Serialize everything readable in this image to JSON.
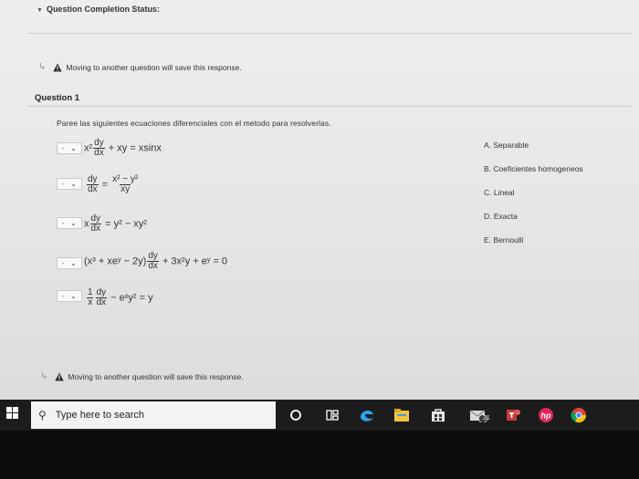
{
  "status": {
    "title": "Question Completion Status:"
  },
  "notice_top": "Moving to another question will save this response.",
  "question": {
    "title": "Question 1",
    "instructions": "Paree las siguientes ecuaciones  diferenciales con el metodo para resolverlas."
  },
  "selects": [
    {
      "value": "-",
      "caret": "⌄"
    },
    {
      "value": "-",
      "caret": "⌄"
    },
    {
      "value": "-",
      "caret": "⌄"
    },
    {
      "value": "-",
      "caret": "⌄"
    },
    {
      "value": "-",
      "caret": "⌄"
    }
  ],
  "equations": {
    "eq1": {
      "coef": "x²",
      "num": "dy",
      "den": "dx",
      "rest": "+ xy = xsinx"
    },
    "eq2": {
      "num": "dy",
      "den": "dx",
      "eq": "=",
      "rnum": "x² − y²",
      "rden": "xy"
    },
    "eq3": {
      "coef": "x",
      "num": "dy",
      "den": "dx",
      "rest": "= y² − xy²"
    },
    "eq4": {
      "lead": "(x³ + xeʸ − 2y)",
      "num": "dy",
      "den": "dx",
      "rest": "+ 3x²y + eʸ = 0"
    },
    "eq5": {
      "n1": "1",
      "d1": "x",
      "n2": "dy",
      "d2": "dx",
      "rest": "− eˣy² = y"
    }
  },
  "options": [
    "A. Separable",
    "B. Coeficientes homogeneos",
    "C. Lineal",
    "D. Exacta",
    "E. Bernoulli"
  ],
  "notice_bottom": "Moving to another question will save this response.",
  "taskbar": {
    "search_placeholder": "Type here to search",
    "badge": "21"
  },
  "colors": {
    "screen_bg": "#e8e8e8",
    "taskbar_bg": "#1c1c1c",
    "warning": "#2d2d2d"
  }
}
